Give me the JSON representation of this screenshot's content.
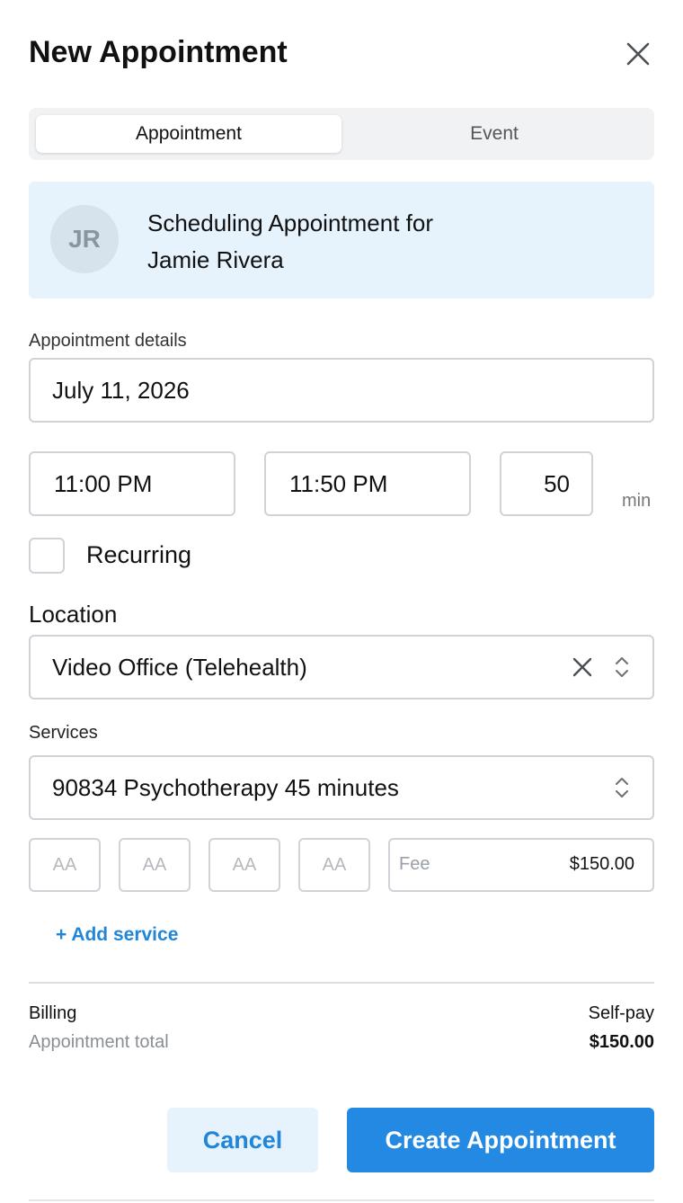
{
  "dialog": {
    "title": "New Appointment"
  },
  "tabs": [
    {
      "label": "Appointment",
      "active": true
    },
    {
      "label": "Event",
      "active": false
    }
  ],
  "client": {
    "initials": "JR",
    "scheduling_line": "Scheduling Appointment for",
    "name": "Jamie Rivera"
  },
  "appointment": {
    "details_label": "Appointment details",
    "date": "July 11, 2026",
    "start_time": "11:00 PM",
    "end_time": "11:50 PM",
    "duration": "50",
    "duration_unit": "min",
    "recurring_label": "Recurring",
    "recurring_checked": false
  },
  "location": {
    "label": "Location",
    "value": "Video Office (Telehealth)"
  },
  "services": {
    "label": "Services",
    "value": "90834 Psychotherapy 45 minutes",
    "modifiers": [
      "AA",
      "AA",
      "AA",
      "AA"
    ],
    "fee_label": "Fee",
    "fee_value": "$150.00",
    "add_label": "+ Add service"
  },
  "billing": {
    "label": "Billing",
    "value": "Self-pay",
    "total_label": "Appointment total",
    "total_value": "$150.00"
  },
  "actions": {
    "cancel_label": "Cancel",
    "create_label": "Create Appointment"
  },
  "colors": {
    "accent": "#2389e2",
    "accent_light": "#e6f3fd",
    "border": "#cfd2d6"
  },
  "icons": {
    "close": "close-icon",
    "clear": "clear-icon",
    "select": "chevron-up-down-icon"
  }
}
